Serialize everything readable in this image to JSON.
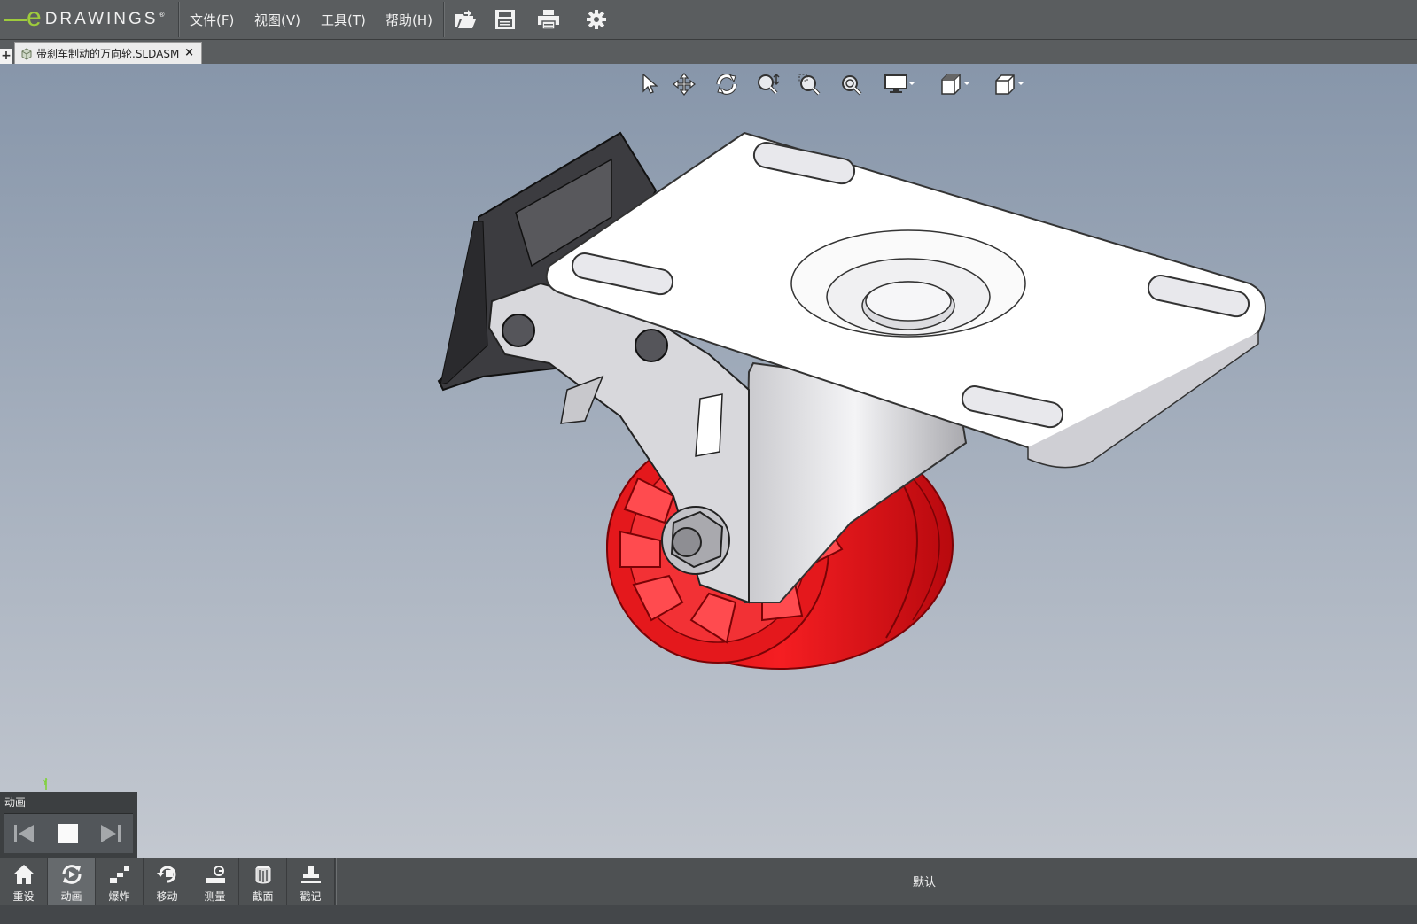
{
  "app": {
    "logo_letter": "e",
    "logo_word": "DRAWINGS",
    "logo_mark": "®"
  },
  "menu": {
    "file": "文件(F)",
    "view": "视图(V)",
    "tools": "工具(T)",
    "help": "帮助(H)"
  },
  "toolbar_icons": [
    "open-icon",
    "save-icon",
    "print-icon",
    "settings-icon"
  ],
  "tab": {
    "title": "带刹车制动的万向轮.SLDASM",
    "close": "×",
    "add": "+"
  },
  "view_toolbar_icons": [
    "select-icon",
    "pan-icon",
    "rotate-icon",
    "zoom-to-fit-icon",
    "zoom-to-area-icon",
    "zoom-in-out-icon",
    "display-style-icon",
    "view-orientation-icon",
    "section-box-icon"
  ],
  "axis": {
    "y": "Y"
  },
  "animation": {
    "title": "动画"
  },
  "bottom": {
    "buttons": [
      "重设",
      "动画",
      "爆炸",
      "移动",
      "测量",
      "截面",
      "戳记"
    ],
    "status": "默认"
  },
  "colors": {
    "wheel": "#e8161b",
    "bracket": "#d8d8dc",
    "plate": "#ffffff",
    "brake": "#3a3a3e",
    "accent": "#9ecb3c"
  }
}
